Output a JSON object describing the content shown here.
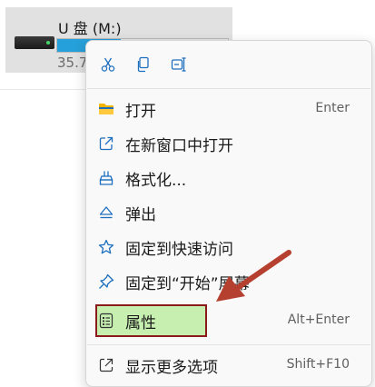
{
  "drive": {
    "name": "U 盘 (M:)",
    "free_text": "35.7",
    "usage_fraction": 0.37,
    "icon": "usb-drive-icon"
  },
  "quick_actions": [
    {
      "name": "cut",
      "icon": "scissors-icon"
    },
    {
      "name": "copy",
      "icon": "copy-icon"
    },
    {
      "name": "rename",
      "icon": "rename-icon"
    }
  ],
  "menu": {
    "items": [
      {
        "label": "打开",
        "shortcut": "Enter",
        "icon": "folder-icon"
      },
      {
        "label": "在新窗口中打开",
        "shortcut": "",
        "icon": "open-external-icon"
      },
      {
        "label": "格式化...",
        "shortcut": "",
        "icon": "format-icon"
      },
      {
        "label": "弹出",
        "shortcut": "",
        "icon": "eject-icon"
      },
      {
        "label": "固定到快速访问",
        "shortcut": "",
        "icon": "star-icon"
      },
      {
        "label": "固定到“开始”屏幕",
        "shortcut": "",
        "icon": "pin-icon"
      },
      {
        "label": "属性",
        "shortcut": "Alt+Enter",
        "icon": "properties-icon"
      },
      {
        "label": "显示更多选项",
        "shortcut": "Shift+F10",
        "icon": "more-options-icon"
      }
    ]
  },
  "annotation": {
    "highlight_color": "#c6efb0",
    "border_color": "#8b1a1a",
    "arrow_color": "#b5402f",
    "arrow_icon": "pointer-arrow-icon"
  },
  "colors": {
    "accent": "#26a0da",
    "icon_blue": "#1f6fbf",
    "folder_yellow": "#f4b400"
  }
}
